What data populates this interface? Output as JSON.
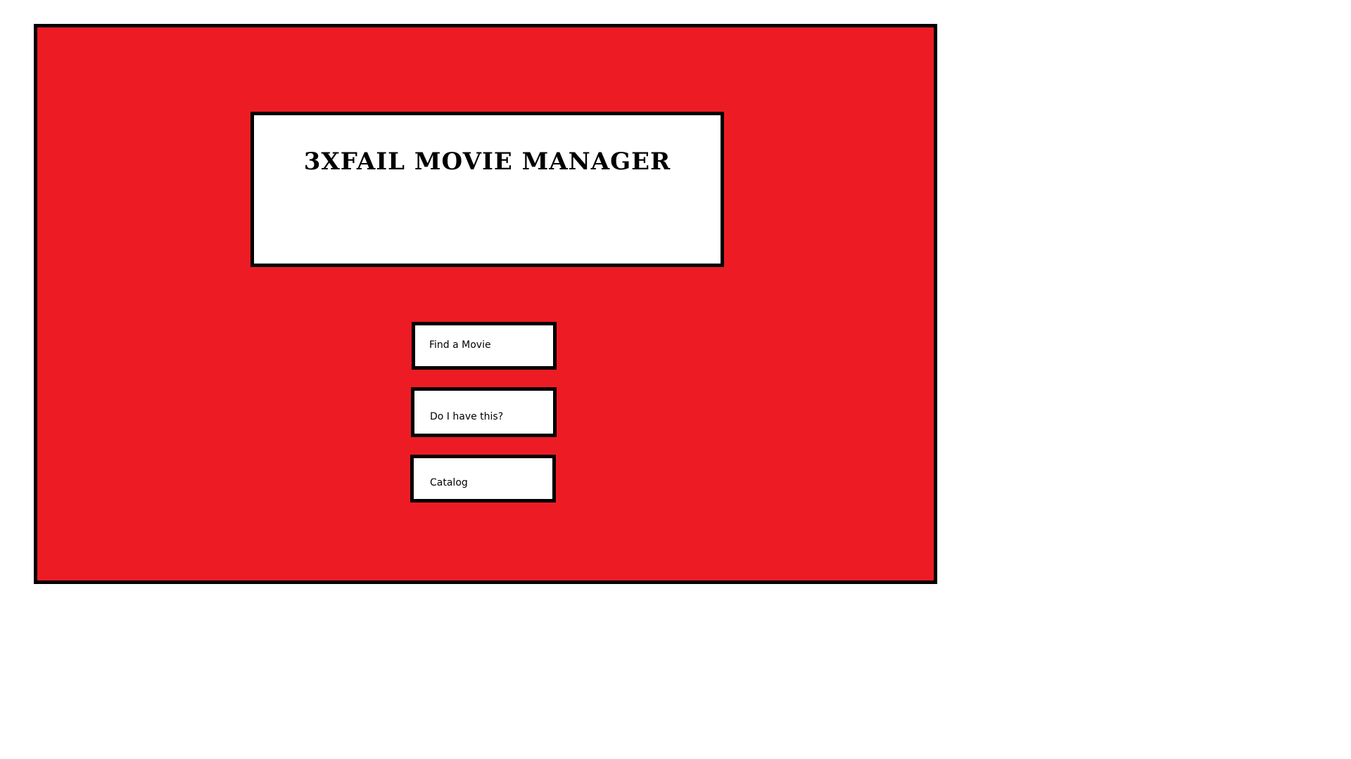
{
  "app": {
    "title": "3XFAIL MOVIE MANAGER",
    "background_color": "#ed1c24",
    "border_color": "#000000"
  },
  "menu": {
    "find_movie_label": "Find a Movie",
    "do_i_have_this_label": "Do I have this?",
    "catalog_label": "Catalog"
  }
}
